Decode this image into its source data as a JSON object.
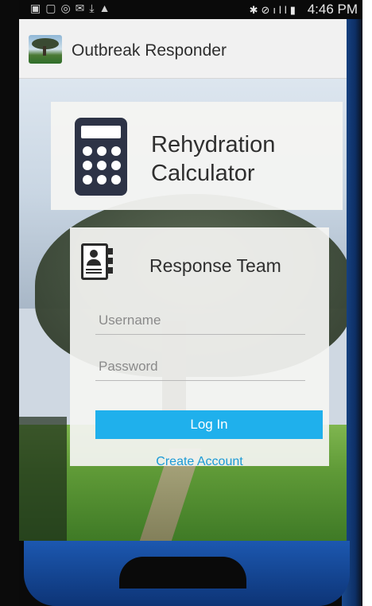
{
  "status_bar": {
    "time": "4:46 PM",
    "icons": [
      "notification-icon",
      "notification-icon",
      "whatsapp-icon",
      "mail-icon",
      "download-icon",
      "warning-icon",
      "bluetooth-icon",
      "mute-icon",
      "wifi-icon",
      "signal-icon",
      "battery-icon"
    ]
  },
  "app_bar": {
    "title": "Outbreak Responder",
    "logo_icon": "tree-landscape-logo"
  },
  "calculator_card": {
    "title_line1": "Rehydration",
    "title_line2": "Calculator",
    "icon": "calculator-icon"
  },
  "login_card": {
    "title": "Response Team",
    "icon": "contact-book-icon",
    "username_placeholder": "Username",
    "password_placeholder": "Password",
    "login_label": "Log In",
    "create_account_label": "Create Account"
  },
  "colors": {
    "accent": "#1fb0ec",
    "link": "#1c9ad6",
    "calc_icon": "#2d3346",
    "app_bar_bg": "#f1f1f1"
  }
}
